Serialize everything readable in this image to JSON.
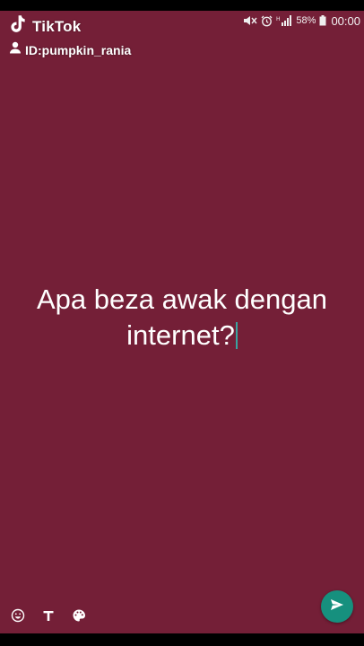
{
  "watermark": {
    "brand": "TikTok",
    "user_id": "ID:pumpkin_rania",
    "brand_icon": "tiktok-note-icon",
    "user_icon": "person-icon"
  },
  "status_bar": {
    "icons": [
      "mute-icon",
      "alarm-icon",
      "signal-icon",
      "battery-icon"
    ],
    "battery": "58%",
    "time": "00:00"
  },
  "status_post": {
    "text": "Apa beza awak dengan internet?",
    "background_color": "#741f37",
    "text_color": "#ffffff"
  },
  "toolbar": {
    "items": [
      "emoji-icon",
      "text-style-icon",
      "palette-icon"
    ]
  },
  "send": {
    "icon": "send-icon",
    "color": "#16907e"
  }
}
